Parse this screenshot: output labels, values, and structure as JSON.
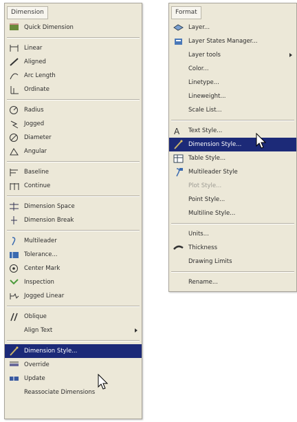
{
  "dimension_menu": {
    "title": "Dimension",
    "groups": [
      [
        {
          "label": "Quick Dimension",
          "icon": "quick-dimension-icon"
        }
      ],
      [
        {
          "label": "Linear",
          "icon": "linear-dim-icon"
        },
        {
          "label": "Aligned",
          "icon": "aligned-dim-icon"
        },
        {
          "label": "Arc Length",
          "icon": "arc-length-icon"
        },
        {
          "label": "Ordinate",
          "icon": "ordinate-icon"
        }
      ],
      [
        {
          "label": "Radius",
          "icon": "radius-icon"
        },
        {
          "label": "Jogged",
          "icon": "jogged-icon"
        },
        {
          "label": "Diameter",
          "icon": "diameter-icon"
        },
        {
          "label": "Angular",
          "icon": "angular-icon"
        }
      ],
      [
        {
          "label": "Baseline",
          "icon": "baseline-icon"
        },
        {
          "label": "Continue",
          "icon": "continue-icon"
        }
      ],
      [
        {
          "label": "Dimension Space",
          "icon": "dimension-space-icon"
        },
        {
          "label": "Dimension Break",
          "icon": "dimension-break-icon"
        }
      ],
      [
        {
          "label": "Multileader",
          "icon": "multileader-icon"
        },
        {
          "label": "Tolerance...",
          "icon": "tolerance-icon"
        },
        {
          "label": "Center Mark",
          "icon": "center-mark-icon"
        },
        {
          "label": "Inspection",
          "icon": "inspection-icon"
        },
        {
          "label": "Jogged Linear",
          "icon": "jogged-linear-icon"
        }
      ],
      [
        {
          "label": "Oblique",
          "icon": "oblique-icon"
        },
        {
          "label": "Align Text",
          "icon": "",
          "submenu": true
        }
      ],
      [
        {
          "label": "Dimension Style...",
          "icon": "dimension-style-icon",
          "highlight": true
        },
        {
          "label": "Override",
          "icon": "override-icon"
        },
        {
          "label": "Update",
          "icon": "update-icon"
        },
        {
          "label": "Reassociate Dimensions",
          "icon": ""
        }
      ]
    ]
  },
  "format_menu": {
    "title": "Format",
    "groups": [
      [
        {
          "label": "Layer...",
          "icon": "layer-icon"
        },
        {
          "label": "Layer States Manager...",
          "icon": "layer-states-icon"
        },
        {
          "label": "Layer tools",
          "icon": "",
          "submenu": true
        },
        {
          "label": "Color...",
          "icon": ""
        },
        {
          "label": "Linetype...",
          "icon": ""
        },
        {
          "label": "Lineweight...",
          "icon": ""
        },
        {
          "label": "Scale List...",
          "icon": ""
        }
      ],
      [
        {
          "label": "Text Style...",
          "icon": "text-style-icon"
        },
        {
          "label": "Dimension Style...",
          "icon": "dimension-style-icon",
          "highlight": true
        },
        {
          "label": "Table Style...",
          "icon": "table-style-icon"
        },
        {
          "label": "Multileader Style",
          "icon": "multileader-style-icon"
        },
        {
          "label": "Plot Style...",
          "icon": "",
          "disabled": true
        },
        {
          "label": "Point Style...",
          "icon": ""
        },
        {
          "label": "Multiline Style...",
          "icon": ""
        }
      ],
      [
        {
          "label": "Units...",
          "icon": ""
        },
        {
          "label": "Thickness",
          "icon": "thickness-icon"
        },
        {
          "label": "Drawing Limits",
          "icon": ""
        }
      ],
      [
        {
          "label": "Rename...",
          "icon": ""
        }
      ]
    ]
  },
  "colors": {
    "highlight": "#1c2a78",
    "menu_bg": "#ece8d8"
  }
}
